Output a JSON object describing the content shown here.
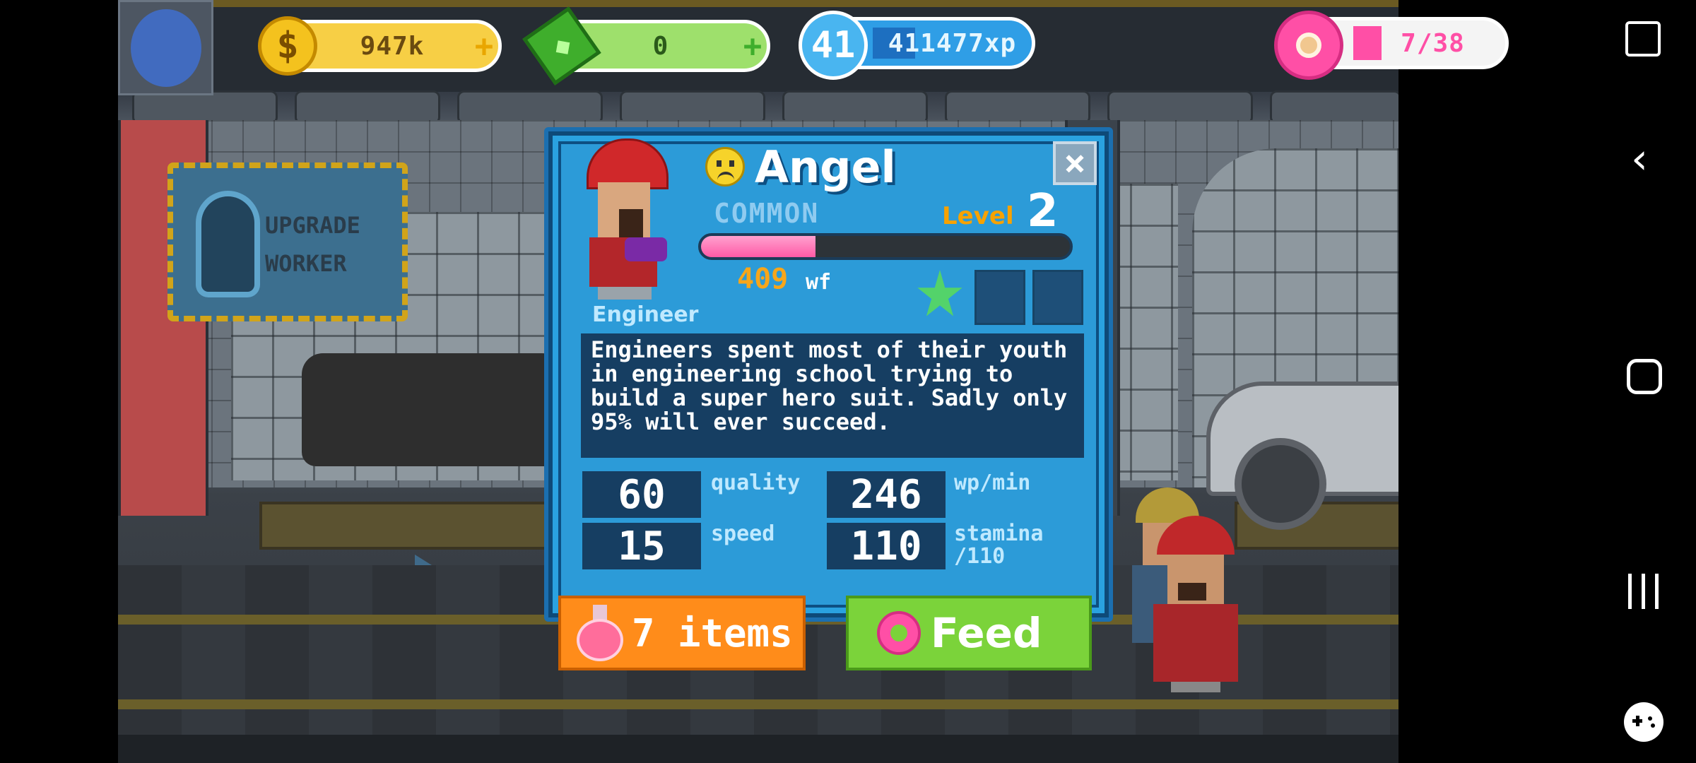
{
  "hud": {
    "coins": "947k",
    "coins_plus": "+",
    "cash": "0",
    "cash_plus": "+",
    "player_level": "41",
    "xp": "411477xp",
    "donuts": "7/38"
  },
  "sign": {
    "line1": "UPGRADE",
    "line2": "WORKER"
  },
  "worker": {
    "name": "Angel",
    "mood_icon": "sad-face-icon",
    "rarity": "COMMON",
    "level_label": "Level",
    "level": "2",
    "level_progress": 0.31,
    "wf_value": "409",
    "wf_unit": "wf",
    "stars_filled": 1,
    "stars_total": 3,
    "job": "Engineer",
    "description": "Engineers spent most of their youth in engineering school trying to build a super hero suit. Sadly only 95% will ever succeed.",
    "stats": {
      "quality": "60",
      "quality_label": "quality",
      "wp_min": "246",
      "wp_min_label": "wp/min",
      "speed": "15",
      "speed_label": "speed",
      "stamina": "110",
      "stamina_label_1": "stamina",
      "stamina_label_2": "/110"
    }
  },
  "buttons": {
    "items": "7 items",
    "feed": "Feed",
    "close": "×"
  },
  "colors": {
    "card_blue": "#2aa2e0",
    "xp_pink": "#ff5aa6",
    "level_orange": "#f7a200",
    "items_orange": "#ff8c1a",
    "feed_green": "#7bd33a"
  }
}
